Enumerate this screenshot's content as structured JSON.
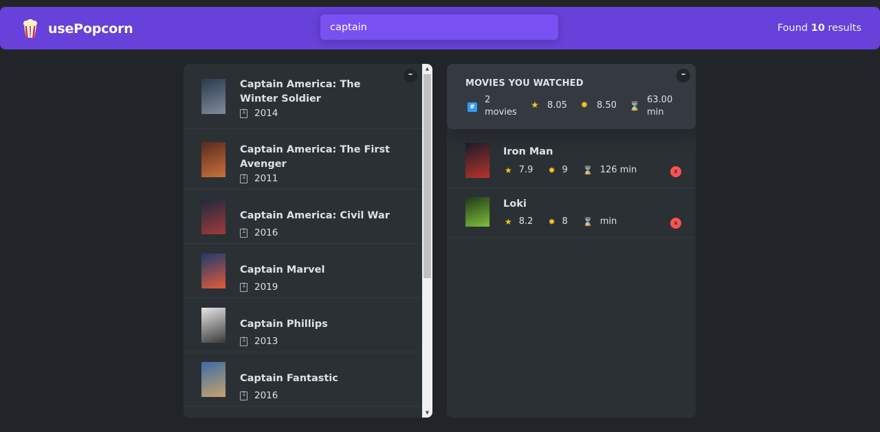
{
  "app": {
    "name": "usePopcorn"
  },
  "search": {
    "value": "captain",
    "placeholder": "Search movies..."
  },
  "results": {
    "prefix": "Found",
    "count": "10",
    "suffix": "results"
  },
  "left_panel": {
    "toggle_label": "–",
    "movies": [
      {
        "title": "Captain America: The Winter Soldier",
        "year": "2014",
        "poster_colors": [
          "#2a3a4e",
          "#7f8c99"
        ]
      },
      {
        "title": "Captain America: The First Avenger",
        "year": "2011",
        "poster_colors": [
          "#5a2a1e",
          "#c9723a"
        ]
      },
      {
        "title": "Captain America: Civil War",
        "year": "2016",
        "poster_colors": [
          "#1e2a3e",
          "#a23a3a"
        ]
      },
      {
        "title": "Captain Marvel",
        "year": "2019",
        "poster_colors": [
          "#1e3a6e",
          "#e35a3a"
        ]
      },
      {
        "title": "Captain Phillips",
        "year": "2013",
        "poster_colors": [
          "#e6e6e6",
          "#3a3a3a"
        ]
      },
      {
        "title": "Captain Fantastic",
        "year": "2016",
        "poster_colors": [
          "#3a6ea5",
          "#c9a26e"
        ]
      }
    ]
  },
  "right_panel": {
    "toggle_label": "–",
    "summary": {
      "title": "MOVIES YOU WATCHED",
      "movies_count": "2",
      "movies_label": "movies",
      "imdb_rating": "8.05",
      "user_rating": "8.50",
      "runtime": "63.00",
      "runtime_unit": "min"
    },
    "watched": [
      {
        "title": "Iron Man",
        "imdb": "7.9",
        "user": "9",
        "runtime": "126 min",
        "delete_label": "x",
        "poster_colors": [
          "#1a1a2a",
          "#b8342a"
        ]
      },
      {
        "title": "Loki",
        "imdb": "8.2",
        "user": "8",
        "runtime": "min",
        "delete_label": "x",
        "poster_colors": [
          "#1f3a1a",
          "#7fbf3a"
        ]
      }
    ]
  },
  "colors": {
    "primary": "#6741d9",
    "primary_light": "#7950f2",
    "background": "#212529",
    "panel": "#2b3035",
    "summary": "#343a40",
    "star": "#fcc419",
    "delete": "#fa5252",
    "hash": "#339af0"
  },
  "icons": {
    "logo": "popcorn-icon",
    "year": "calendar-icon",
    "count": "hash-icon",
    "imdb": "star-icon",
    "user": "sun-icon",
    "runtime": "hourglass-icon"
  }
}
